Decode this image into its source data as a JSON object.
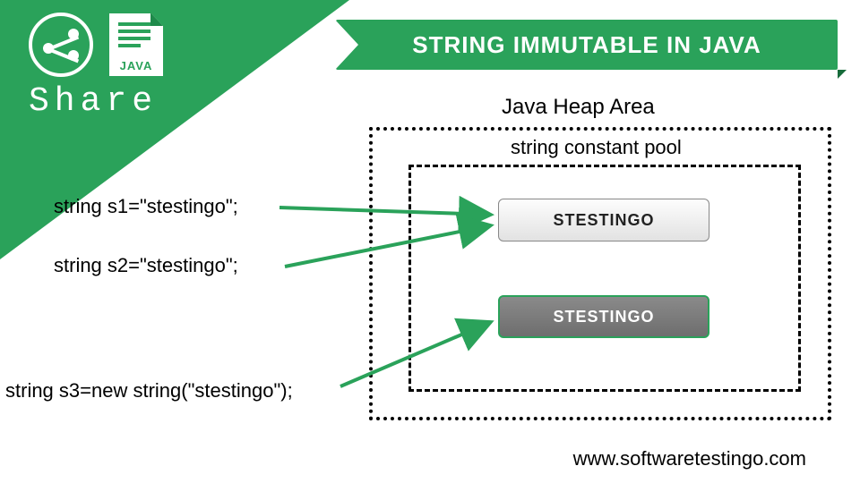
{
  "share": {
    "label": "Share",
    "file_tag": "JAVA"
  },
  "banner": {
    "title": "STRING IMMUTABLE IN JAVA"
  },
  "heap": {
    "title": "Java Heap Area",
    "pool_label": "string constant pool"
  },
  "objects": {
    "pool_value": "STESTINGO",
    "heap_value": "STESTINGO"
  },
  "code": {
    "line1": "string s1=\"stestingo\";",
    "line2": "string s2=\"stestingo\";",
    "line3": "string s3=new string(\"stestingo\");"
  },
  "footer": {
    "url": "www.softwaretestingo.com"
  },
  "colors": {
    "brand": "#2aa25a"
  }
}
